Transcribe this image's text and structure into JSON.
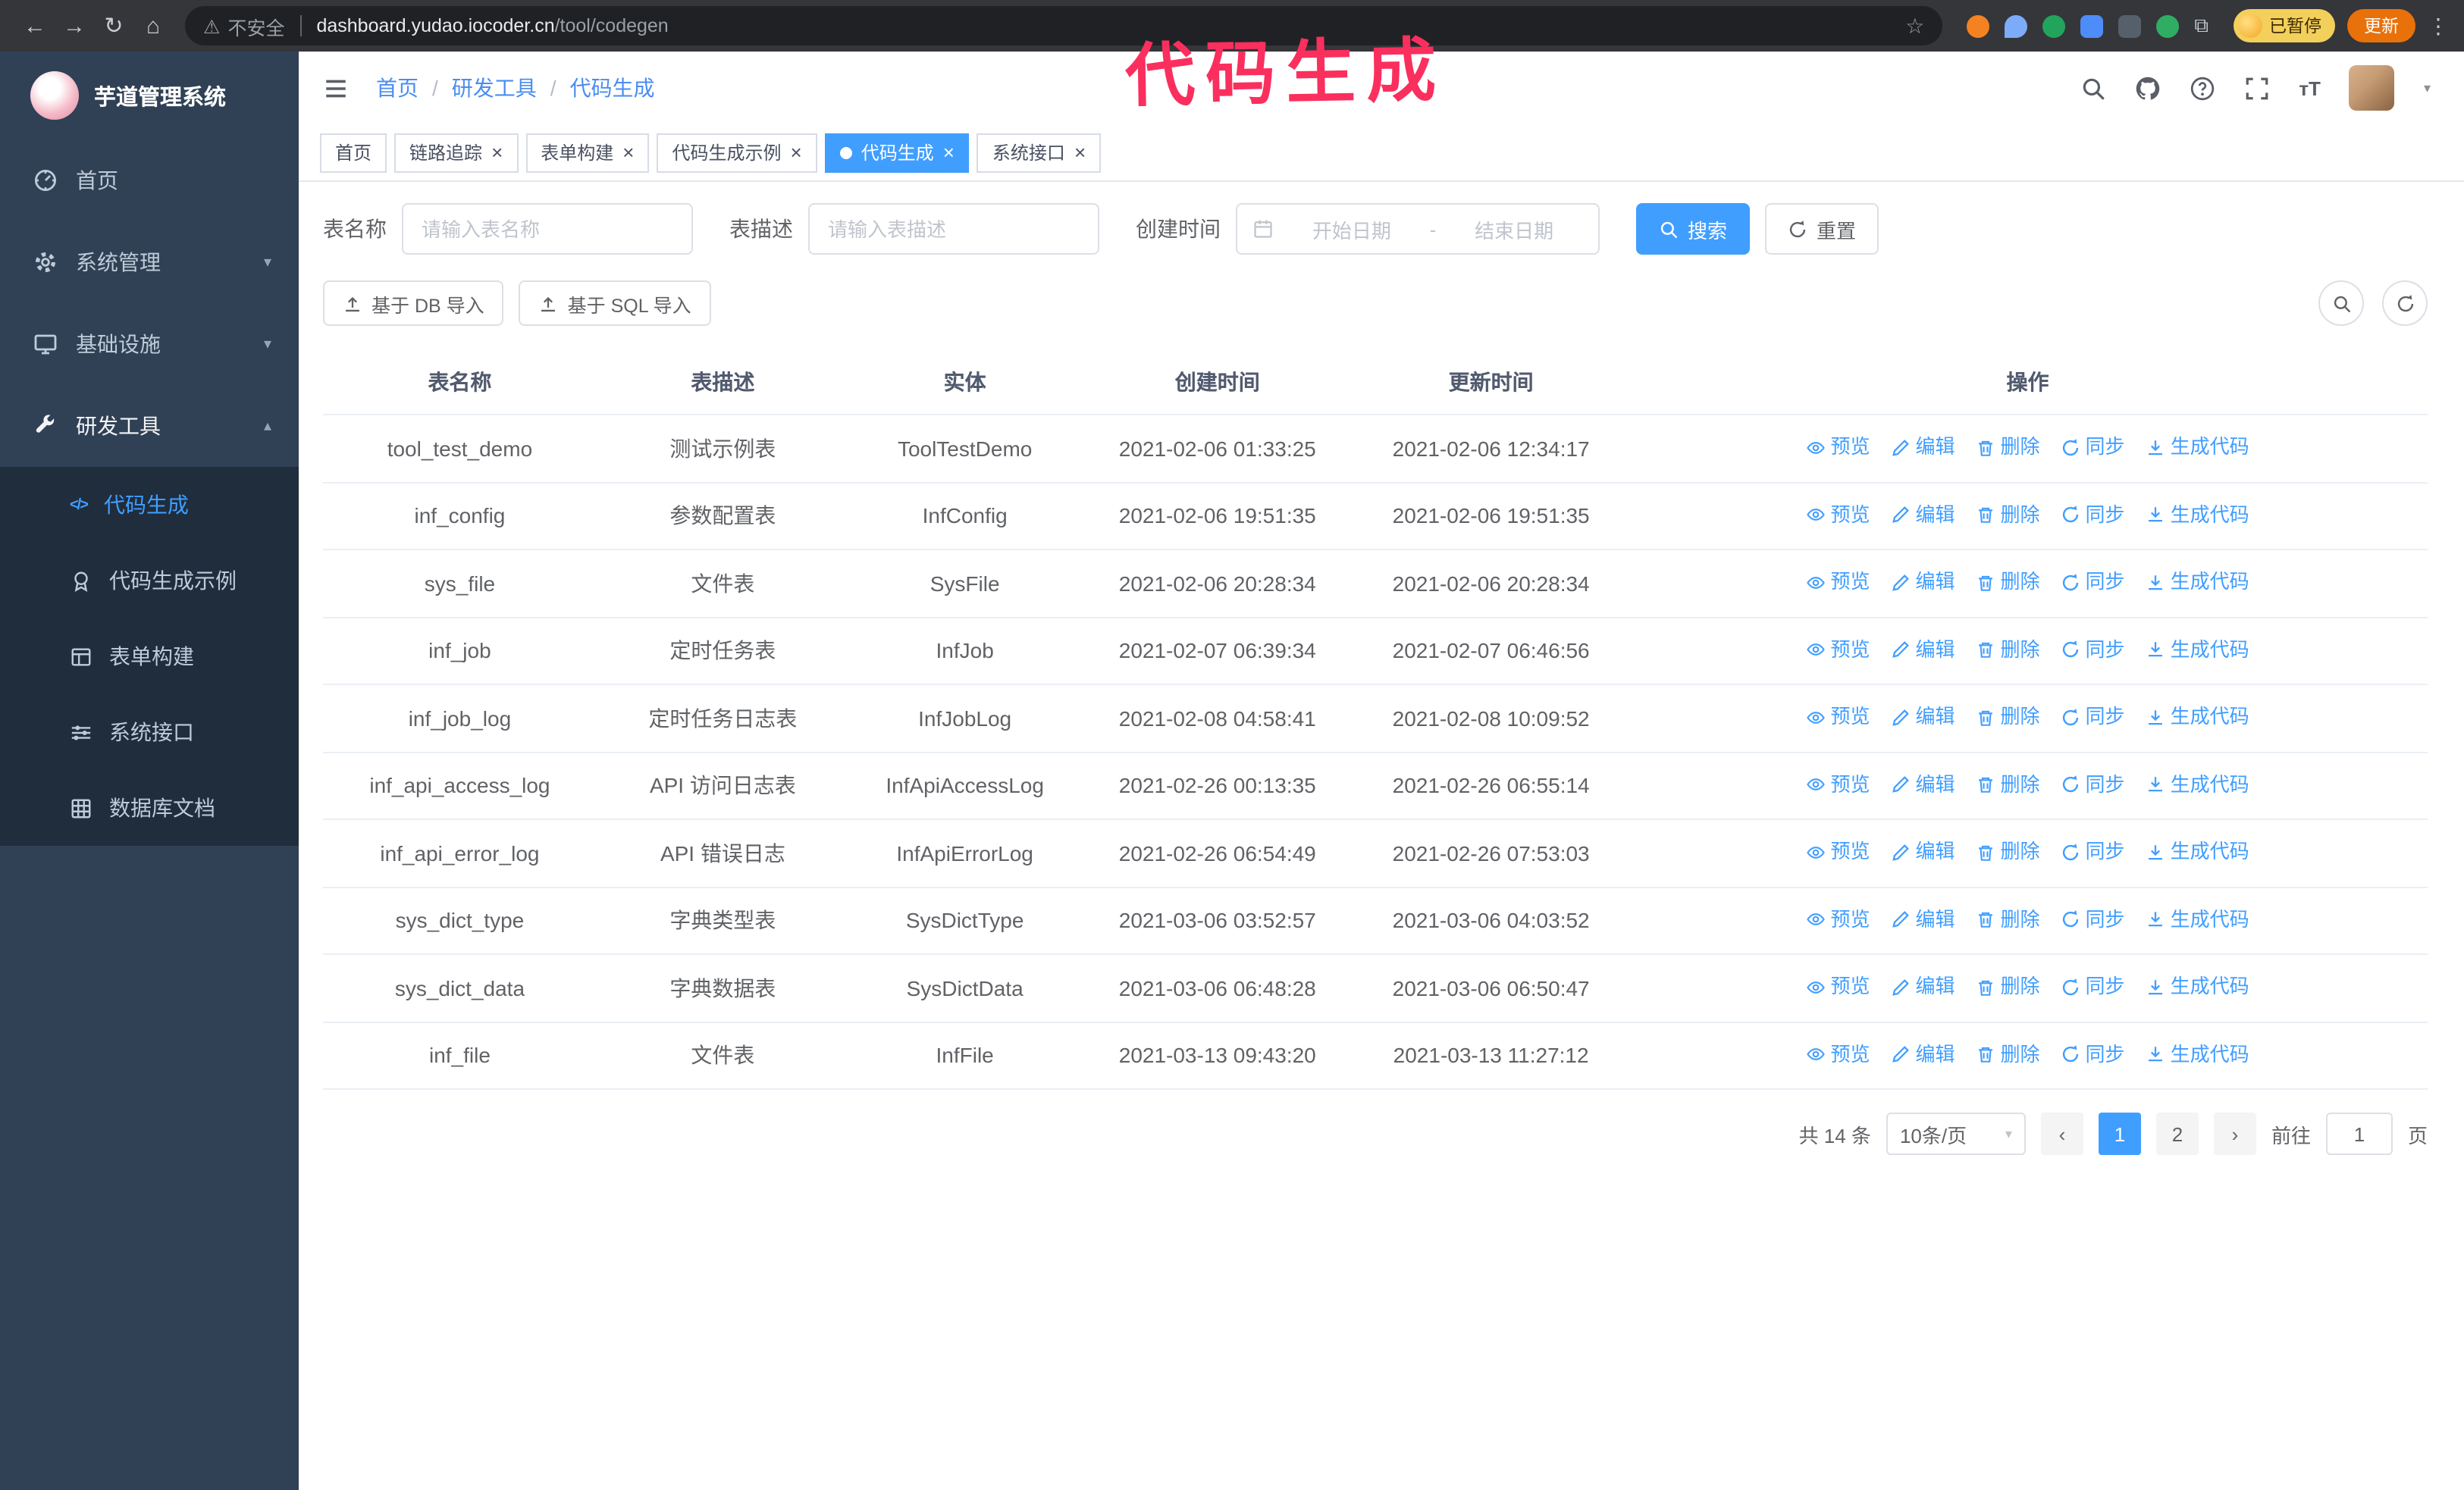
{
  "colors": {
    "accent": "#409eff",
    "annotation": "#fa2f5e",
    "update_button": "#e8710a"
  },
  "annotation": {
    "text": "代码生成"
  },
  "icons": {
    "back": "←",
    "forward": "→",
    "reload": "↻",
    "home": "⌂",
    "warning": "⚠",
    "star": "☆",
    "puzzle": "⧉",
    "kebab": "⋮",
    "close": "×",
    "caret_down": "▾",
    "caret_up": "▴",
    "prev": "‹",
    "next": "›",
    "code": "</>",
    "font_size": "тT",
    "separator": "/"
  },
  "browser": {
    "security_label": "不安全",
    "url_host": "dashboard.yudao.iocoder.cn",
    "url_path": "/tool/codegen",
    "paused_badge": "已暂停",
    "update_button": "更新"
  },
  "sidebar": {
    "logo_title": "芋道管理系统",
    "items": [
      {
        "label": "首页"
      },
      {
        "label": "系统管理"
      },
      {
        "label": "基础设施"
      },
      {
        "label": "研发工具"
      }
    ],
    "sub_items": [
      {
        "label": "代码生成"
      },
      {
        "label": "代码生成示例"
      },
      {
        "label": "表单构建"
      },
      {
        "label": "系统接口"
      },
      {
        "label": "数据库文档"
      }
    ]
  },
  "header": {
    "breadcrumb": [
      "首页",
      "研发工具",
      "代码生成"
    ]
  },
  "tabs": [
    {
      "label": "首页"
    },
    {
      "label": "链路追踪"
    },
    {
      "label": "表单构建"
    },
    {
      "label": "代码生成示例"
    },
    {
      "label": "代码生成"
    },
    {
      "label": "系统接口"
    }
  ],
  "filters": {
    "table_name_label": "表名称",
    "table_name_placeholder": "请输入表名称",
    "table_desc_label": "表描述",
    "table_desc_placeholder": "请输入表描述",
    "create_time_label": "创建时间",
    "date_start_placeholder": "开始日期",
    "date_separator": "-",
    "date_end_placeholder": "结束日期",
    "search_button": "搜索",
    "reset_button": "重置"
  },
  "toolbar": {
    "import_db": "基于 DB 导入",
    "import_sql": "基于 SQL 导入"
  },
  "table": {
    "columns": [
      "表名称",
      "表描述",
      "实体",
      "创建时间",
      "更新时间",
      "操作"
    ],
    "actions": [
      "预览",
      "编辑",
      "删除",
      "同步",
      "生成代码"
    ],
    "rows": [
      {
        "name": "tool_test_demo",
        "desc": "测试示例表",
        "entity": "ToolTestDemo",
        "created": "2021-02-06 01:33:25",
        "updated": "2021-02-06 12:34:17"
      },
      {
        "name": "inf_config",
        "desc": "参数配置表",
        "entity": "InfConfig",
        "created": "2021-02-06 19:51:35",
        "updated": "2021-02-06 19:51:35"
      },
      {
        "name": "sys_file",
        "desc": "文件表",
        "entity": "SysFile",
        "created": "2021-02-06 20:28:34",
        "updated": "2021-02-06 20:28:34"
      },
      {
        "name": "inf_job",
        "desc": "定时任务表",
        "entity": "InfJob",
        "created": "2021-02-07 06:39:34",
        "updated": "2021-02-07 06:46:56"
      },
      {
        "name": "inf_job_log",
        "desc": "定时任务日志表",
        "entity": "InfJobLog",
        "created": "2021-02-08 04:58:41",
        "updated": "2021-02-08 10:09:52"
      },
      {
        "name": "inf_api_access_log",
        "desc": "API 访问日志表",
        "entity": "InfApiAccessLog",
        "created": "2021-02-26 00:13:35",
        "updated": "2021-02-26 06:55:14"
      },
      {
        "name": "inf_api_error_log",
        "desc": "API 错误日志",
        "entity": "InfApiErrorLog",
        "created": "2021-02-26 06:54:49",
        "updated": "2021-02-26 07:53:03"
      },
      {
        "name": "sys_dict_type",
        "desc": "字典类型表",
        "entity": "SysDictType",
        "created": "2021-03-06 03:52:57",
        "updated": "2021-03-06 04:03:52"
      },
      {
        "name": "sys_dict_data",
        "desc": "字典数据表",
        "entity": "SysDictData",
        "created": "2021-03-06 06:48:28",
        "updated": "2021-03-06 06:50:47"
      },
      {
        "name": "inf_file",
        "desc": "文件表",
        "entity": "InfFile",
        "created": "2021-03-13 09:43:20",
        "updated": "2021-03-13 11:27:12"
      }
    ]
  },
  "pagination": {
    "total": "共 14 条",
    "page_size": "10条/页",
    "pages": [
      "1",
      "2"
    ],
    "goto_label": "前往",
    "goto_value": "1",
    "goto_unit": "页"
  }
}
